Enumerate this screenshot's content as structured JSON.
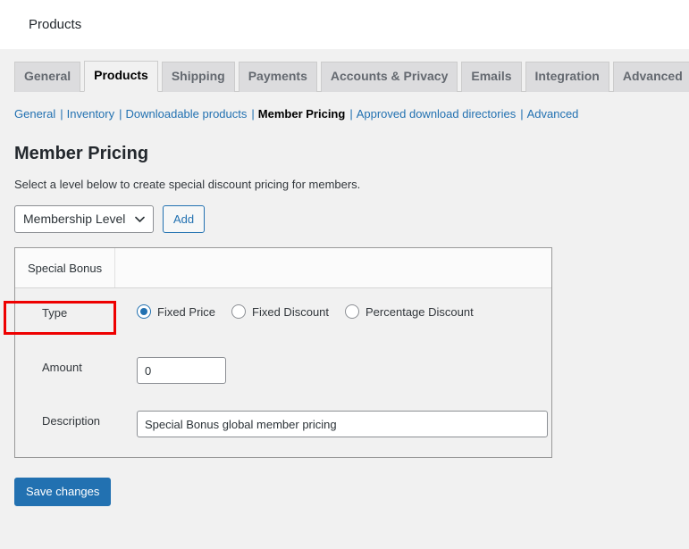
{
  "header": {
    "title": "Products"
  },
  "tabs": [
    {
      "label": "General",
      "active": false
    },
    {
      "label": "Products",
      "active": true
    },
    {
      "label": "Shipping",
      "active": false
    },
    {
      "label": "Payments",
      "active": false
    },
    {
      "label": "Accounts & Privacy",
      "active": false
    },
    {
      "label": "Emails",
      "active": false
    },
    {
      "label": "Integration",
      "active": false
    },
    {
      "label": "Advanced",
      "active": false
    }
  ],
  "subnav": [
    {
      "label": "General",
      "current": false
    },
    {
      "label": "Inventory",
      "current": false
    },
    {
      "label": "Downloadable products",
      "current": false
    },
    {
      "label": "Member Pricing",
      "current": true
    },
    {
      "label": "Approved download directories",
      "current": false
    },
    {
      "label": "Advanced",
      "current": false
    }
  ],
  "subnav_separator": "|",
  "section": {
    "title": "Member Pricing",
    "description": "Select a level below to create special discount pricing for members."
  },
  "controls": {
    "level_select_value": "Membership Level",
    "level_select_options": [
      "Membership Level"
    ],
    "add_button_label": "Add"
  },
  "panel": {
    "tabs": [
      {
        "label": "Special Bonus",
        "active": true
      }
    ],
    "fields": {
      "type": {
        "label": "Type",
        "options": [
          {
            "label": "Fixed Price",
            "checked": true
          },
          {
            "label": "Fixed Discount",
            "checked": false
          },
          {
            "label": "Percentage Discount",
            "checked": false
          }
        ]
      },
      "amount": {
        "label": "Amount",
        "value": "0",
        "placeholder": ""
      },
      "description": {
        "label": "Description",
        "value": "Special Bonus global member pricing",
        "placeholder": ""
      }
    }
  },
  "footer": {
    "save_label": "Save changes"
  },
  "annotation": {
    "color": "#ee0000",
    "target": "Special Bonus"
  },
  "colors": {
    "accent": "#2271b1",
    "page_bg": "#f1f1f1",
    "tab_inactive_bg": "#dcdcde",
    "annotation": "#ee0000"
  }
}
